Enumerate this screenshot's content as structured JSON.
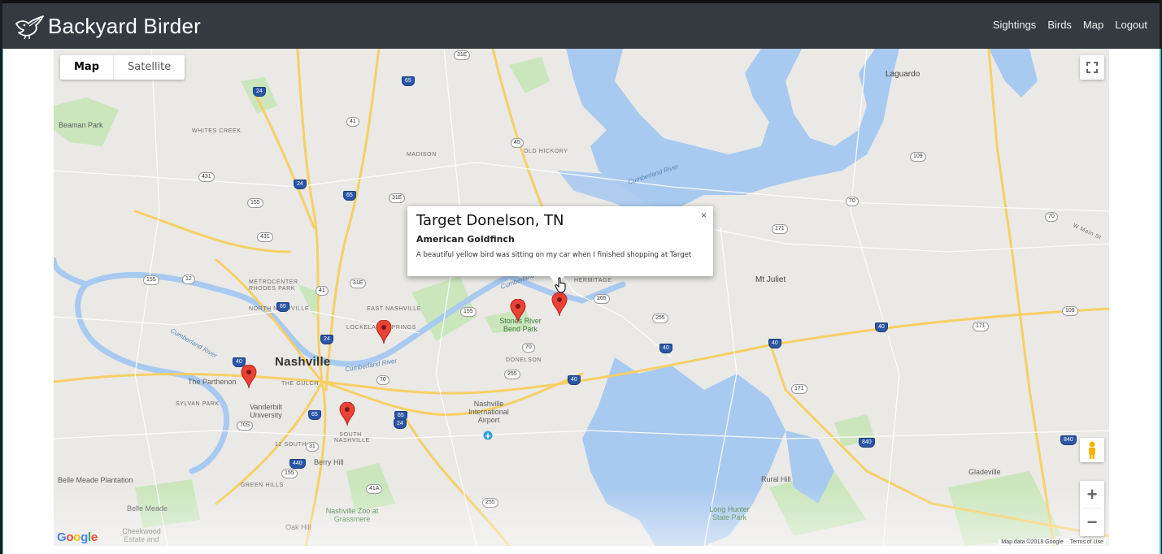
{
  "navbar": {
    "brand": "Backyard Birder",
    "brand_icon": "bird-icon",
    "links": [
      "Sightings",
      "Birds",
      "Map",
      "Logout"
    ]
  },
  "map": {
    "type_control": {
      "options": [
        "Map",
        "Satellite"
      ],
      "selected": "Map"
    },
    "controls": {
      "fullscreen_icon": "fullscreen-icon",
      "pegman_icon": "pegman-icon",
      "zoom_in": "+",
      "zoom_out": "−"
    },
    "google_logo": "Google",
    "attribution": {
      "data": "Map data ©2018 Google",
      "terms": "Terms of Use"
    },
    "info_window": {
      "title": "Target Donelson, TN",
      "bird": "American Goldfinch",
      "description": "A beautiful yellow bird was sitting on my car when I finished shopping at Target",
      "close": "×"
    },
    "marker_color": "#ea4335",
    "places": {
      "nashville": "Nashville",
      "laguardo": "Laguardo",
      "beaman_park": "Beaman Park",
      "whites_creek": "WHITES CREEK",
      "madison": "MADISON",
      "old_hickory": "OLD HICKORY",
      "cumberland_river_1": "Cumberland River",
      "cumberland_river_2": "Cumberland River",
      "cumberland_river_3": "Cumberland River",
      "cumberland_river_4": "Cumberland River",
      "mt_juliet": "Mt Juliet",
      "metrocenter": "METROCENTER",
      "rhodes_park": "RHODES PARK",
      "north_nashville": "NORTH NASHVILLE",
      "east_nashville": "EAST NASHVILLE",
      "lockeland_springs": "LOCKELAND SPRINGS",
      "hermitage": "HERMITAGE",
      "stones_river": "Stones River Bend Park",
      "donelson": "DONELSON",
      "the_parthenon": "The Parthenon",
      "vanderbilt": "Vanderbilt University",
      "sylvan_park": "SYLVAN PARK",
      "the_gulch": "THE GULCH",
      "south_nashville": "SOUTH NASHVILLE",
      "twelve_south": "12 SOUTH",
      "airport": "Nashville International Airport",
      "berry_hill": "Berry Hill",
      "belle_meade_plantation": "Belle Meade Plantation",
      "green_hills": "GREEN HILLS",
      "belle_meade": "Belle Meade",
      "nashville_zoo": "Nashville Zoo at Grassmere",
      "oak_hill": "Oak Hill",
      "cheekwood": "Cheekwood Estate and",
      "long_hunter": "Long Hunter State Park",
      "rural_hill": "Rural Hill",
      "gladeville": "Gladeville",
      "w_main_st": "W Main St"
    },
    "shields": [
      "31E",
      "65",
      "24",
      "41",
      "45",
      "431",
      "24",
      "65",
      "31E",
      "155",
      "431",
      "12",
      "155",
      "41",
      "31E",
      "65",
      "155",
      "24",
      "70",
      "265",
      "65",
      "40",
      "70",
      "255",
      "24",
      "40",
      "70S",
      "31",
      "65",
      "440",
      "155",
      "41A",
      "255",
      "171",
      "109",
      "70",
      "171",
      "40",
      "40",
      "840",
      "109",
      "70",
      "255",
      "40",
      "171",
      "840"
    ]
  }
}
